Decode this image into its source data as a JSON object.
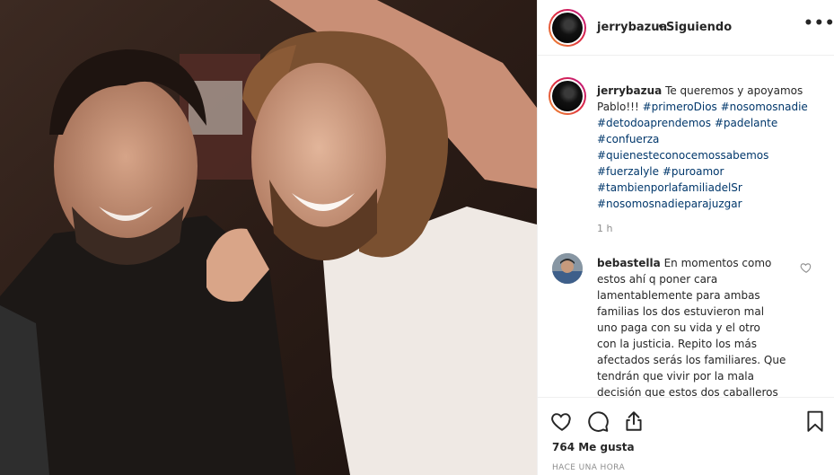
{
  "post": {
    "username": "jerrybazua",
    "dot": "•",
    "follow_status": "Siguiendo",
    "more_label": "•••"
  },
  "caption": {
    "username": "jerrybazua",
    "text_lines": [
      [
        "Te queremos y apoyamos"
      ],
      [
        "Pablo!!! ",
        "#primeroDios",
        " ",
        "#nosomosnadie"
      ],
      [
        "#detodoaprendemos",
        " ",
        "#padelante"
      ],
      [
        "#confuerza"
      ],
      [
        "#quienesteconocemossabemos"
      ],
      [
        "#fuerzalyle",
        " ",
        "#puroamor"
      ],
      [
        "#tambienporlafamiliadelSr"
      ],
      [
        "#nosomosnadieparajuzgar"
      ]
    ],
    "text_line1": "Te queremos y apoyamos",
    "text_line2_plain": "Pablo!!! ",
    "hashtags": [
      "#primeroDios",
      "#nosomosnadie",
      "#detodoaprendemos",
      "#padelante",
      "#confuerza",
      "#quienesteconocemossabemos",
      "#fuerzalyle",
      "#puroamor",
      "#tambienporlafamiliadelSr",
      "#nosomosnadieparajuzgar"
    ],
    "time": "1 h"
  },
  "comment": {
    "username": "bebastella",
    "lines": [
      "En momentos como",
      "estos ahí q poner cara",
      "lamentablemente para ambas",
      "familias los dos estuvieron mal",
      "uno paga con su vida y el otro",
      "con la justicia. Repito los más",
      "afectados serás los familiares. Que",
      "tendrán que vivir por la mala",
      "decisión que estos dos caballeros"
    ]
  },
  "actions": {
    "icons": [
      "heart-icon",
      "comment-icon",
      "share-icon",
      "bookmark-icon"
    ],
    "likes": "764 Me gusta",
    "posted_ago": "HACE UNA HORA"
  },
  "colors": {
    "hashtag": "#00376b",
    "muted": "#8e8e8e",
    "text": "#262626",
    "border": "#efefef"
  }
}
